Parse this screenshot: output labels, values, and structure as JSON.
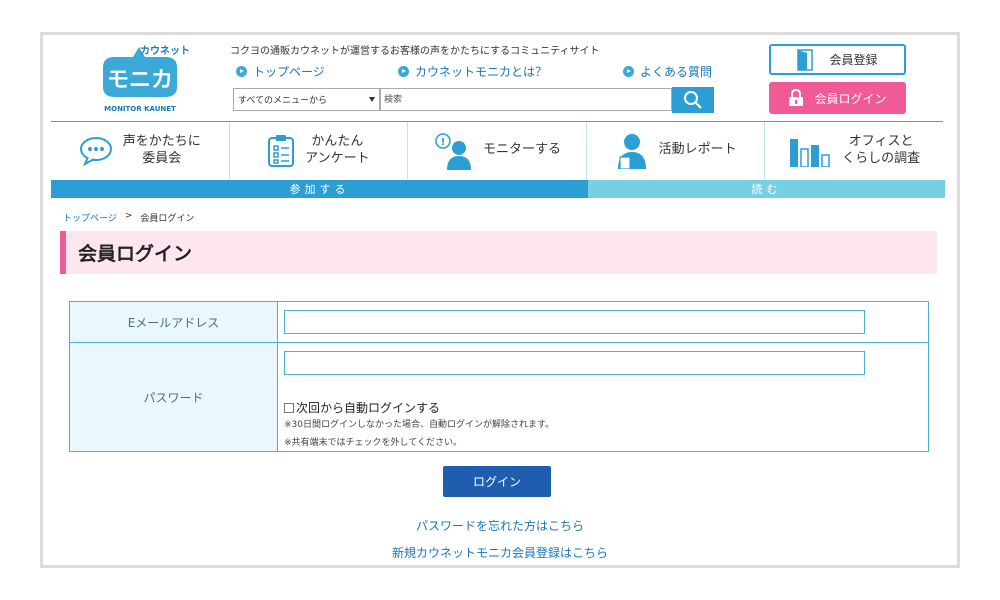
{
  "header": {
    "logo": {
      "katakana": "カウネット",
      "main": "モニカ",
      "sub": "MONITOR KAUNET"
    },
    "tagline": "コクヨの通販カウネットが運営するお客様の声をかたちにするコミュニティサイト",
    "links": [
      "トップページ",
      "カウネットモニカとは？",
      "よくある質問"
    ],
    "menu_select": "すべてのメニューから",
    "search_placeholder": "検索",
    "register_label": "会員登録",
    "login_label": "会員ログイン"
  },
  "nav": {
    "items": [
      {
        "label": "声をかたちに\n委員会",
        "icon": "speech-bubble-icon"
      },
      {
        "label": "かんたん\nアンケート",
        "icon": "clipboard-icon"
      },
      {
        "label": "モニターする",
        "icon": "person-idea-icon"
      },
      {
        "label": "活動レポート",
        "icon": "person-report-icon"
      },
      {
        "label": "オフィスと\nくらしの調査",
        "icon": "bar-chart-icon"
      }
    ],
    "section_participate": "参加する",
    "section_read": "読む"
  },
  "breadcrumb": {
    "home": "トップページ",
    "separator": ">",
    "current": "会員ログイン"
  },
  "page_title": "会員ログイン",
  "form": {
    "email_label": "Eメールアドレス",
    "password_label": "パスワード",
    "auto_login_label": "次回から自動ログインする",
    "note1": "※30日間ログインしなかった場合、自動ログインが解除されます。",
    "note2": "※共有端末ではチェックを外してください。",
    "login_button": "ログイン"
  },
  "links": {
    "forgot_password": "パスワードを忘れた方はこちら",
    "new_register": "新規カウネットモニカ会員登録はこちら"
  },
  "colors": {
    "brand_blue": "#2b9fd4",
    "pink": "#f05a96",
    "login_blue": "#1f5eae"
  }
}
